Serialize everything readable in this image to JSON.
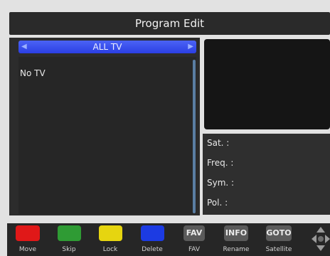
{
  "header": {
    "title": "Program Edit"
  },
  "list": {
    "group": "ALL TV",
    "items": [
      "No TV"
    ]
  },
  "info": {
    "sat": "Sat. :",
    "freq": "Freq. :",
    "sym": "Sym. :",
    "pol": "Pol. :"
  },
  "footer": {
    "move": "Move",
    "skip": "Skip",
    "lock": "Lock",
    "delete": "Delete",
    "fav_key": "FAV",
    "fav": "FAV",
    "info_key": "INFO",
    "rename": "Rename",
    "goto_key": "GOTO",
    "satellite": "Satellite"
  },
  "colors": {
    "red": "#e01818",
    "green": "#2f9b34",
    "yellow": "#e6d510",
    "blue": "#1c3be3"
  }
}
